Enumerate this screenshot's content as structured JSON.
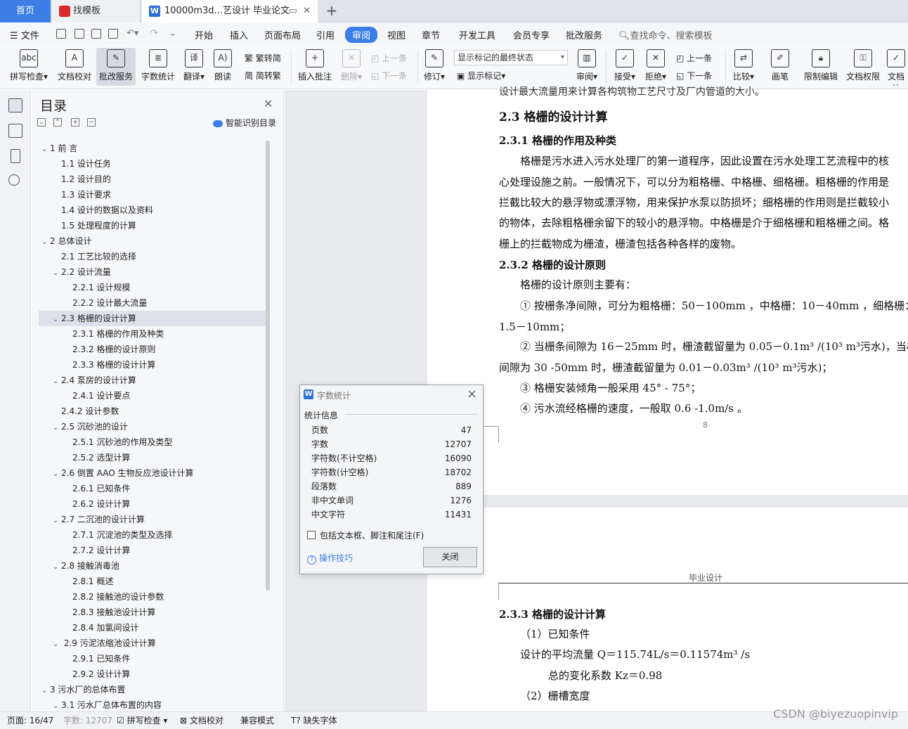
{
  "tabs": {
    "home": "首页",
    "template": "找模板",
    "document": "10000m3d...艺设计 毕业论文"
  },
  "menu": {
    "file": "文件",
    "items": [
      "开始",
      "插入",
      "页面布局",
      "引用",
      "审阅",
      "视图",
      "章节",
      "开发工具",
      "会员专享",
      "批改服务"
    ],
    "active": "审阅",
    "search": "查找命令、搜索模板"
  },
  "ribbon": {
    "spell_check": "拼写检查",
    "doc_proof": "文档校对",
    "correction_service": "批改服务",
    "word_count": "字数统计",
    "translate": "翻译",
    "read_aloud": "朗读",
    "trad_to_simp": "繁转简",
    "simp_to_trad": "简转繁",
    "insert_comment": "插入批注",
    "delete": "删除",
    "prev_comment": "上一条",
    "next_comment": "下一条",
    "revise": "修订",
    "markup_select": "显示标记的最终状态",
    "show_markup": "显示标记",
    "review": "审阅",
    "accept": "接受",
    "reject": "拒绝",
    "prev_change": "上一条",
    "next_change": "下一条",
    "compare": "比较",
    "pen": "画笔",
    "restrict_edit": "限制编辑",
    "doc_permission": "文档权限",
    "doc_more": "文档认"
  },
  "toc": {
    "title": "目录",
    "smart": "智能识别目录",
    "items": [
      {
        "level": 1,
        "arrow": "v",
        "text": "1 前 言"
      },
      {
        "level": 2,
        "arrow": "",
        "text": "1.1  设计任务"
      },
      {
        "level": 2,
        "arrow": "",
        "text": "1.2  设计目的"
      },
      {
        "level": 2,
        "arrow": "",
        "text": "1.3  设计要求"
      },
      {
        "level": 2,
        "arrow": "",
        "text": "1.4 设计的数据以及资料"
      },
      {
        "level": 2,
        "arrow": "",
        "text": "1.5  处理程度的计算"
      },
      {
        "level": 1,
        "arrow": "v",
        "text": "2  总体设计"
      },
      {
        "level": 2,
        "arrow": "",
        "text": "2.1 工艺比较的选择"
      },
      {
        "level": 2,
        "arrow": "v",
        "text": "2.2 设计流量"
      },
      {
        "level": 3,
        "arrow": "",
        "text": "2.2.1  设计规模"
      },
      {
        "level": 3,
        "arrow": "",
        "text": "2.2.2  设计最大流量"
      },
      {
        "level": 2,
        "arrow": "v",
        "text": "2.3  格栅的设计计算",
        "selected": true
      },
      {
        "level": 3,
        "arrow": "",
        "text": "2.3.1 格栅的作用及种类"
      },
      {
        "level": 3,
        "arrow": "",
        "text": "2.3.2 格栅的设计原则"
      },
      {
        "level": 3,
        "arrow": "",
        "text": "2.3.3  格栅的设计计算"
      },
      {
        "level": 2,
        "arrow": "v",
        "text": "2.4  泵房的设计计算"
      },
      {
        "level": 3,
        "arrow": "",
        "text": "2.4.1  设计要点"
      },
      {
        "level": 2,
        "arrow": "",
        "text": "2.4.2  设计参数"
      },
      {
        "level": 2,
        "arrow": "v",
        "text": "2.5 沉砂池的设计"
      },
      {
        "level": 3,
        "arrow": "",
        "text": "2.5.1 沉砂池的作用及类型"
      },
      {
        "level": 3,
        "arrow": "",
        "text": "2.5.2  选型计算"
      },
      {
        "level": 2,
        "arrow": "v",
        "text": "2.6  倒置  AAO 生物反应池设计计算"
      },
      {
        "level": 3,
        "arrow": "",
        "text": "2.6.1  已知条件"
      },
      {
        "level": 3,
        "arrow": "",
        "text": "2.6.2  设计计算"
      },
      {
        "level": 2,
        "arrow": "v",
        "text": "2.7  二沉池的设计计算"
      },
      {
        "level": 3,
        "arrow": "",
        "text": "2.7.1 沉淀池的类型及选择"
      },
      {
        "level": 3,
        "arrow": "",
        "text": "2.7.2 设计计算"
      },
      {
        "level": 2,
        "arrow": "v",
        "text": "2.8  接触消毒池"
      },
      {
        "level": 3,
        "arrow": "",
        "text": "2.8.1  概述"
      },
      {
        "level": 3,
        "arrow": "",
        "text": "2.8.2 接触池的设计参数"
      },
      {
        "level": 3,
        "arrow": "",
        "text": "2.8.3  接触池设计计算"
      },
      {
        "level": 3,
        "arrow": "",
        "text": "2.8.4  加氯间设计"
      },
      {
        "level": 2,
        "arrow": "v",
        "text": " 2.9  污泥浓缩池设计计算"
      },
      {
        "level": 3,
        "arrow": "",
        "text": "2.9.1  已知条件"
      },
      {
        "level": 3,
        "arrow": "",
        "text": "2.9.2 设计计算"
      },
      {
        "level": 1,
        "arrow": "v",
        "text": "3  污水厂的总体布置"
      },
      {
        "level": 2,
        "arrow": "v",
        "text": "3.1  污水厂总体布置的内容"
      }
    ]
  },
  "doc": {
    "top_cut": "设计最大流量用来计算各构筑物工艺尺寸及厂内管道的大小。",
    "h_23": "2.3  格栅的设计计算",
    "h_231": "2.3.1 格栅的作用及种类",
    "p1": [
      "格栅是污水进入污水处理厂的第一道程序，因此设置在污水处理工艺流程中的核",
      "心处理设施之前。一般情况下，可以分为粗格栅、中格栅、细格栅。粗格栅的作用是",
      "拦截比较大的悬浮物或漂浮物，用来保护水泵以防损坏；细格栅的作用则是拦截较小",
      "的物体，去除粗格栅余留下的较小的悬浮物。中格栅是介于细格栅和粗格栅之间。格",
      "栅上的拦截物成为栅渣，栅渣包括各种各样的废物。"
    ],
    "h_232": "2.3.2 格栅的设计原则",
    "p2_intro": "格栅的设计原则主要有：",
    "p2_1a": "①  按栅条净间隙，可分为粗格栅：50－100mm  ，中格栅：10－40mm  ，细格栅：",
    "p2_1b": "1.5－10mm；",
    "p2_2a": "②  当栅条间隙为 16－25mm 时，栅渣截留量为 0.05－0.1m³ /(10³ m³污水)，当栅条",
    "p2_2b": "间隙为 30 -50mm 时，栅渣截留量为 0.01－0.03m³ /(10³ m³污水)；",
    "p2_3": "③  格栅安装倾角一般采用 45° - 75°；",
    "p2_4": "④  污水流经格栅的速度，一般取 0.6 -1.0m/s  。",
    "page_num": "8",
    "header2": "毕业设计",
    "h_233": "2.3.3  格栅的设计计算",
    "p3_1": "（1）已知条件",
    "p3_2": "设计的平均流量 Q＝115.74L/s＝0.11574m³ /s",
    "p3_3": "总的变化系数      Kz＝0.98",
    "p3_4": "（2）栅槽宽度"
  },
  "dialog": {
    "title": "字数统计",
    "section": "统计信息",
    "stats": [
      {
        "label": "页数",
        "value": "47"
      },
      {
        "label": "字数",
        "value": "12707"
      },
      {
        "label": "字符数(不计空格)",
        "value": "16090"
      },
      {
        "label": "字符数(计空格)",
        "value": "18702"
      },
      {
        "label": "段落数",
        "value": "889"
      },
      {
        "label": "非中文单词",
        "value": "1276"
      },
      {
        "label": "中文字符",
        "value": "11431"
      }
    ],
    "checkbox": "包括文本框、脚注和尾注(F)",
    "tips": "操作技巧",
    "close": "关闭"
  },
  "status": {
    "page": "页面: 16/47",
    "words": "字数: 12707",
    "spell": "拼写检查",
    "proof": "文档校对",
    "compat": "兼容模式",
    "missing_font": "缺失字体"
  },
  "watermark": "CSDN @biyezuopinvip"
}
